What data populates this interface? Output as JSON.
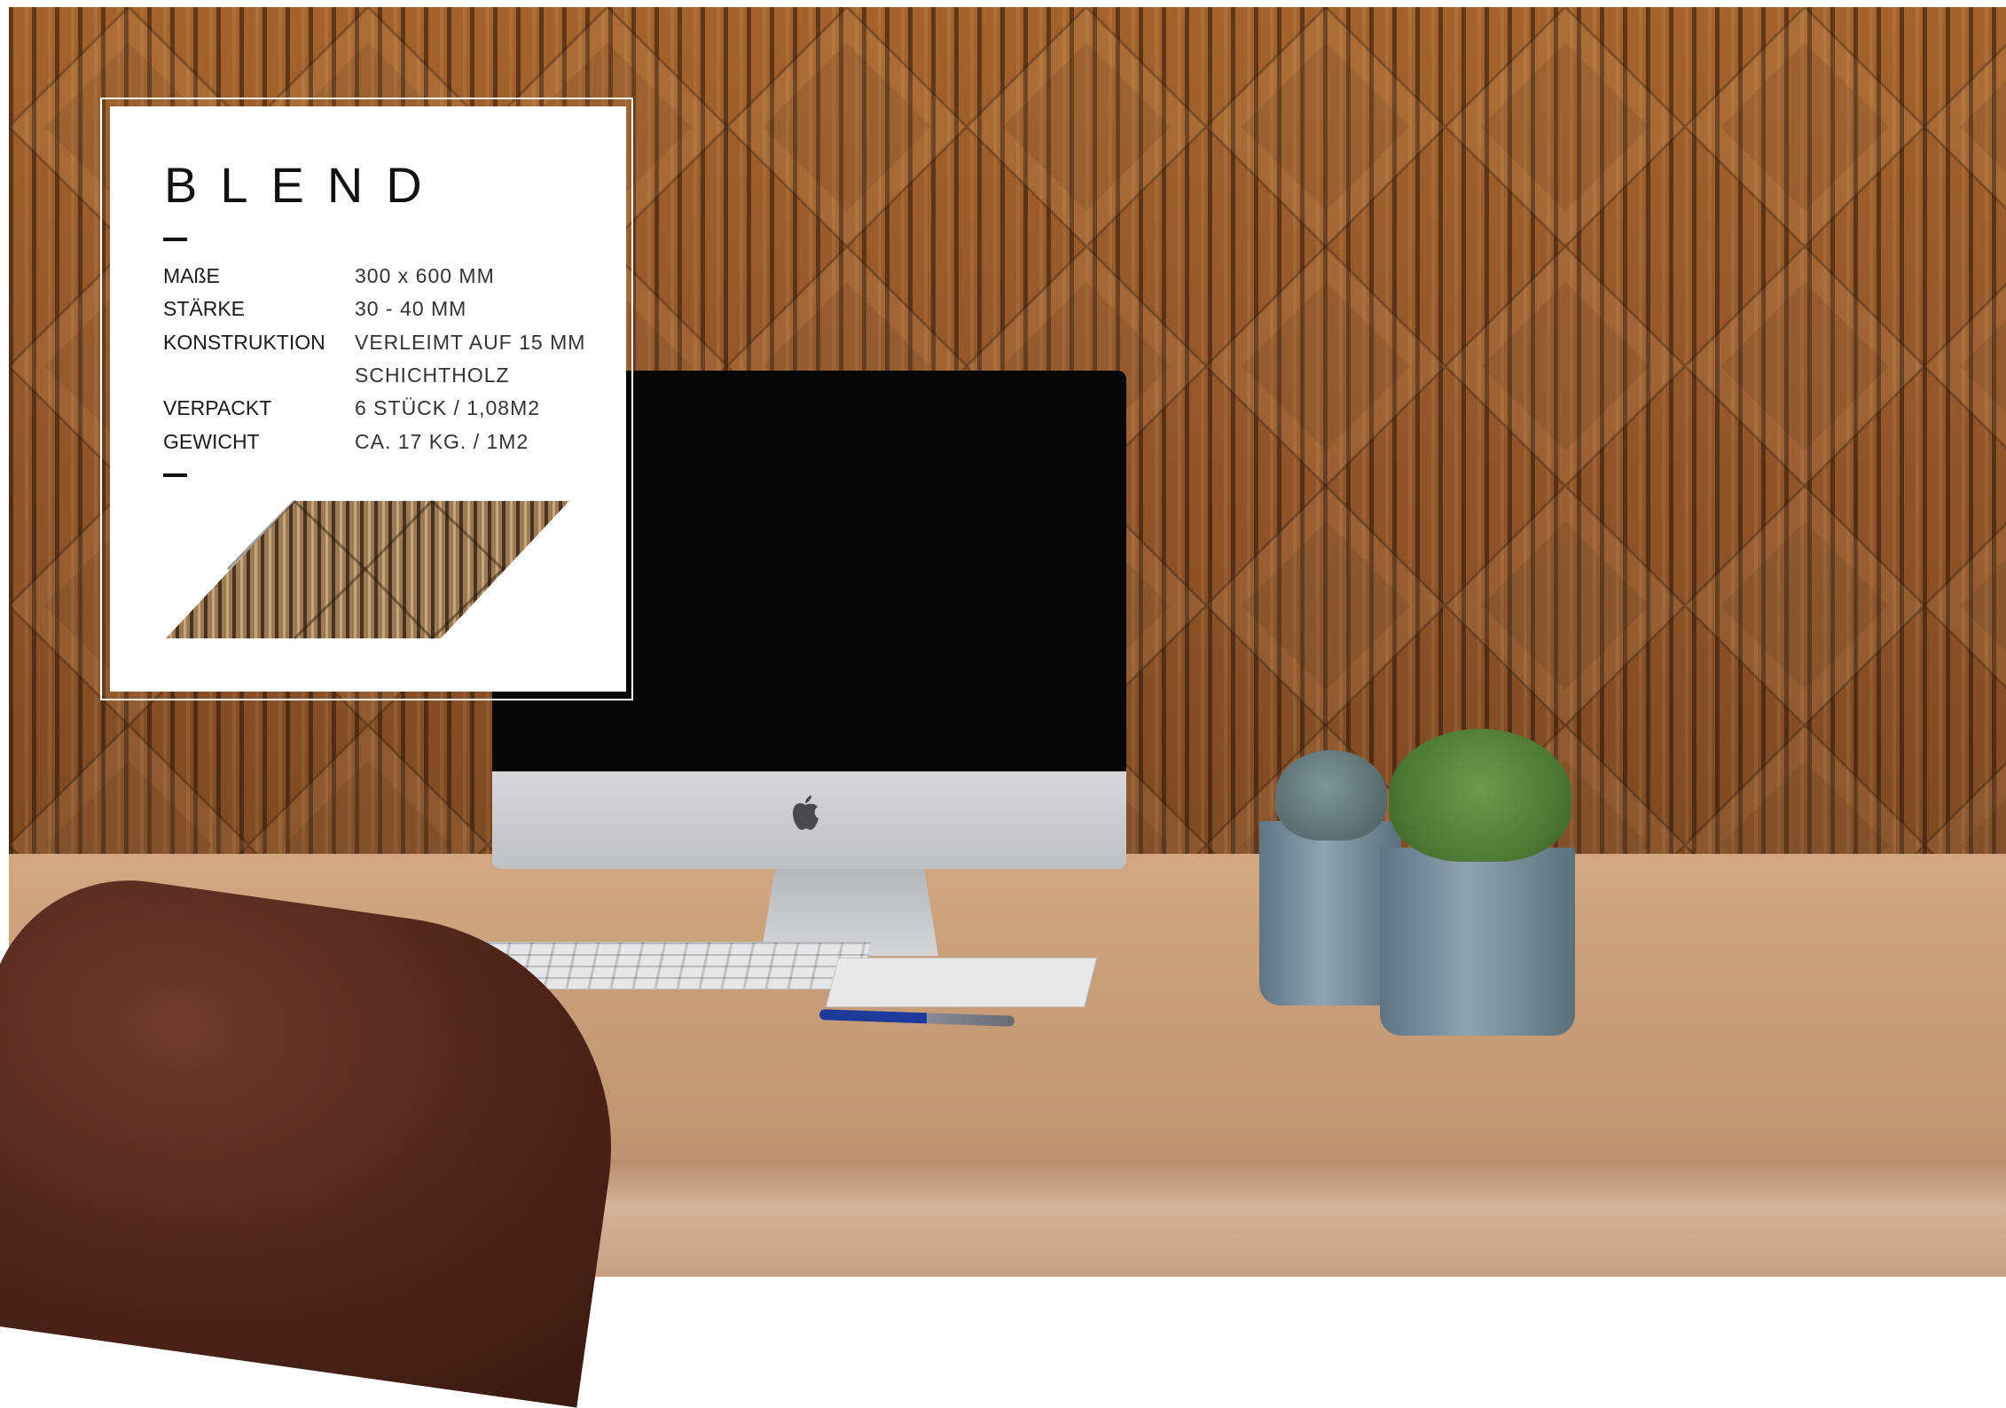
{
  "product": {
    "name": "BLEND",
    "specs": [
      {
        "label": "MAßE",
        "value": "300 x 600 MM"
      },
      {
        "label": "STÄRKE",
        "value": "30 - 40 MM"
      },
      {
        "label": "KONSTRUKTION",
        "value": "VERLEIMT AUF 15 MM"
      },
      {
        "label": "",
        "value": "SCHICHTHOLZ"
      },
      {
        "label": "VERPACKT",
        "value": "6 STÜCK / 1,08M2"
      },
      {
        "label": "GEWICHT",
        "value": "CA. 17 KG. / 1M2"
      }
    ]
  },
  "colors": {
    "card_background": "#ffffff",
    "text": "#111111",
    "wood": "#94562a"
  },
  "icons": [
    "apple-logo-icon"
  ]
}
